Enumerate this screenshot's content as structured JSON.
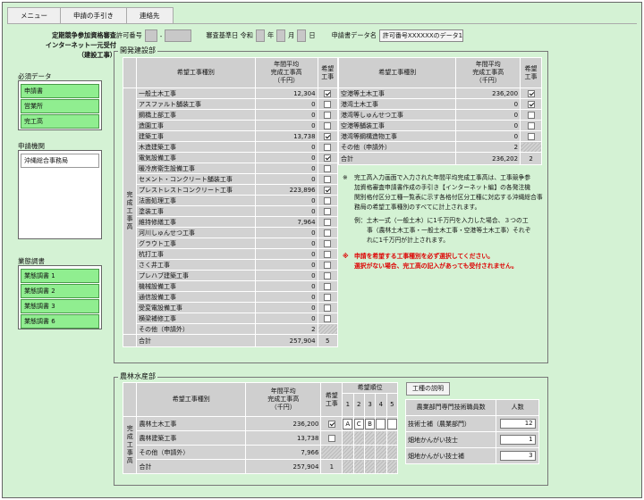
{
  "nav": {
    "menu": "メニュー",
    "guide": "申請の手引き",
    "contact": "連絡先"
  },
  "header": {
    "title_lines": [
      "定期競争参加資格審査",
      "インターネット一元受付",
      "（建設工事）"
    ],
    "permit_label": "許可番号",
    "base_date_label": "審査基準日 令和",
    "year_suffix": "年",
    "month_suffix": "月",
    "day_suffix": "日",
    "dataname_label": "申請書データ名",
    "dataname_value": "許可番号XXXXXXのデータ1"
  },
  "sidebar": {
    "required_label": "必須データ",
    "required_items": [
      "申請書",
      "営業所",
      "完工高"
    ],
    "agency_label": "申請機関",
    "agency_items": [
      "沖縄総合事務局"
    ],
    "survey_label": "業態調書",
    "survey_items": [
      "業態調書 1",
      "業態調書 2",
      "業態調書 3",
      "業態調書 6"
    ]
  },
  "kaihatsu": {
    "title": "開発建設部",
    "vert_label": "完成工事高",
    "col_type": "希望工事種別",
    "col_amount": "年間平均\n完成工事高\n（千円）",
    "col_hope": "希望\n工事",
    "left_rows": [
      {
        "name": "一般土木工事",
        "amount": "12,304",
        "checked": true
      },
      {
        "name": "アスファルト舗装工事",
        "amount": "0",
        "checked": false
      },
      {
        "name": "鋼橋上部工事",
        "amount": "0",
        "checked": false
      },
      {
        "name": "造園工事",
        "amount": "0",
        "checked": false
      },
      {
        "name": "建築工事",
        "amount": "13,738",
        "checked": true
      },
      {
        "name": "木造建築工事",
        "amount": "0",
        "checked": false
      },
      {
        "name": "電気設備工事",
        "amount": "0",
        "checked": true
      },
      {
        "name": "暖冷房衛生設備工事",
        "amount": "0",
        "checked": false
      },
      {
        "name": "セメント・コンクリート舗装工事",
        "amount": "0",
        "checked": false
      },
      {
        "name": "プレストレストコンクリート工事",
        "amount": "223,896",
        "checked": true
      },
      {
        "name": "法面処理工事",
        "amount": "0",
        "checked": false
      },
      {
        "name": "塗装工事",
        "amount": "0",
        "checked": false
      },
      {
        "name": "維持修繕工事",
        "amount": "7,964",
        "checked": false
      },
      {
        "name": "河川しゅんせつ工事",
        "amount": "0",
        "checked": false
      },
      {
        "name": "グラウト工事",
        "amount": "0",
        "checked": false
      },
      {
        "name": "杭打工事",
        "amount": "0",
        "checked": false
      },
      {
        "name": "さく井工事",
        "amount": "0",
        "checked": false
      },
      {
        "name": "プレハブ建築工事",
        "amount": "0",
        "checked": false
      },
      {
        "name": "機械設備工事",
        "amount": "0",
        "checked": false
      },
      {
        "name": "通信設備工事",
        "amount": "0",
        "checked": false
      },
      {
        "name": "受変電設備工事",
        "amount": "0",
        "checked": false
      },
      {
        "name": "横梁補修工事",
        "amount": "0",
        "checked": false
      }
    ],
    "left_other": {
      "name": "その他（申請外）",
      "amount": "2"
    },
    "left_total": {
      "name": "合計",
      "amount": "257,904",
      "count": "5"
    },
    "right_rows": [
      {
        "name": "空港等土木工事",
        "amount": "236,200",
        "checked": true
      },
      {
        "name": "港湾土木工事",
        "amount": "0",
        "checked": true
      },
      {
        "name": "港湾等しゅんせつ工事",
        "amount": "0",
        "checked": false
      },
      {
        "name": "空港等舗装工事",
        "amount": "0",
        "checked": false
      },
      {
        "name": "港湾等鋼構造物工事",
        "amount": "0",
        "checked": false
      }
    ],
    "right_other": {
      "name": "その他（申請外）",
      "amount": "2"
    },
    "right_total": {
      "name": "合計",
      "amount": "236,202",
      "count": "2"
    },
    "notes": {
      "mark1": "※",
      "n1": [
        "完工高入力画面で入力された年間平均完成工事高は、工事競争参",
        "加資格審査申請書作成の手引き【インターネット編】の各発注機",
        "関別格付区分工種一覧表に示す各格付区分工種に対応する沖縄総合事",
        "務局の希望工事種別のすべてに計上されます。"
      ],
      "n2": [
        "例：土木一式（一般土木）に1千万円を入力した場合、３つの工",
        "事（農林土木工事・一般土木工事・空港等土木工事）それぞ",
        "れに1千万円が計上されます。"
      ],
      "mark2": "※",
      "r1": "申請を希望する工事種別を必ず選択してください。",
      "r2": "選択がない場合、完工高の記入があっても受付されません。"
    }
  },
  "nourin": {
    "title": "農林水産部",
    "vert_label": "完成工事高",
    "col_type": "希望工事種別",
    "col_amount": "年間平均\n完成工事高\n（千円）",
    "col_hope": "希望\n工事",
    "prio_label": "希望順位",
    "prio_cols": [
      "1",
      "2",
      "3",
      "4",
      "5"
    ],
    "rows": [
      {
        "name": "農林土木工事",
        "amount": "236,200",
        "checked": true,
        "prio": [
          "A",
          "C",
          "B",
          "",
          ""
        ]
      },
      {
        "name": "農林建築工事",
        "amount": "13,738",
        "checked": false
      }
    ],
    "other": {
      "name": "その他（申請外）",
      "amount": "7,966"
    },
    "total": {
      "name": "合計",
      "amount": "257,904",
      "count": "1"
    },
    "explain_button": "工種の説明",
    "staff_col1": "農業部門専門技術職員数",
    "staff_col2": "人数",
    "staff_rows": [
      {
        "name": "技術士補（農業部門）",
        "count": "12"
      },
      {
        "name": "畑地かんがい技士",
        "count": "1"
      },
      {
        "name": "畑地かんがい技士補",
        "count": "3"
      }
    ]
  }
}
